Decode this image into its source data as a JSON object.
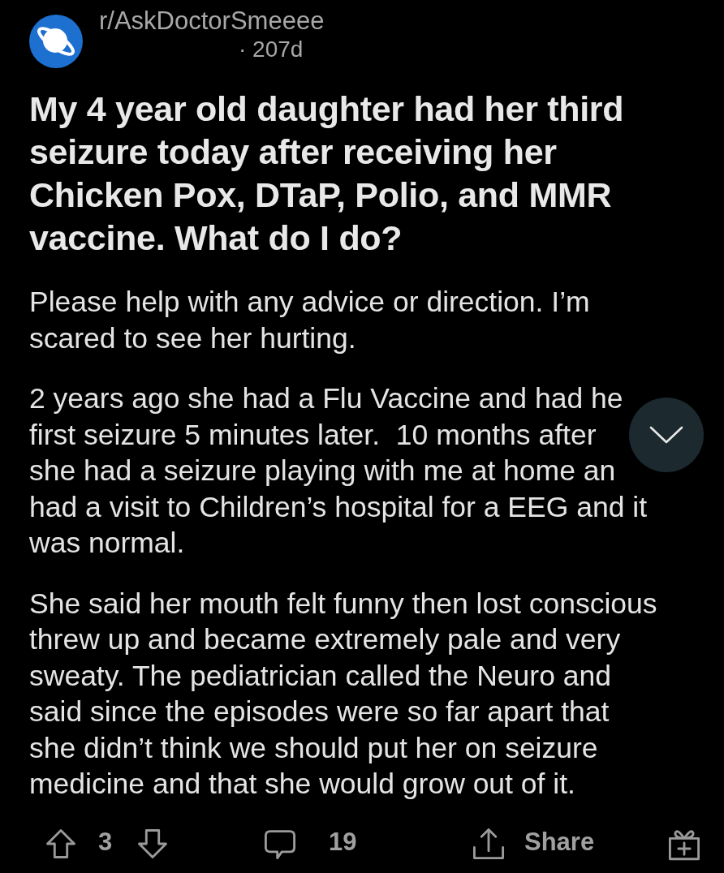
{
  "post": {
    "subreddit": "r/AskDoctorSmeeee",
    "age": "· 207d",
    "title_lines": [
      "My 4 year old daughter had her third",
      "seizure today after receiving her",
      "Chicken Pox, DTaP, Polio, and MMR",
      "vaccine. What do I do?"
    ],
    "paragraphs": [
      {
        "lines": [
          "Please help with any advice or direction. I’m",
          "scared to see her hurting."
        ]
      },
      {
        "lines": [
          "2 years ago she had a Flu Vaccine and had he",
          "first seizure 5 minutes later.  10 months after",
          "she had a seizure playing with me at home an",
          "had a visit to Children’s hospital for a EEG and it",
          "was normal."
        ]
      },
      {
        "lines": [
          "She said her mouth felt funny then lost conscious",
          "threw up and became extremely pale and very",
          "sweaty. The pediatrician called the Neuro and",
          "said since the episodes were so far apart that",
          "she didn’t think we should put her on seizure",
          "medicine and that she would grow out of it."
        ]
      }
    ]
  },
  "actions": {
    "votes": "3",
    "comments": "19",
    "share": "Share"
  }
}
